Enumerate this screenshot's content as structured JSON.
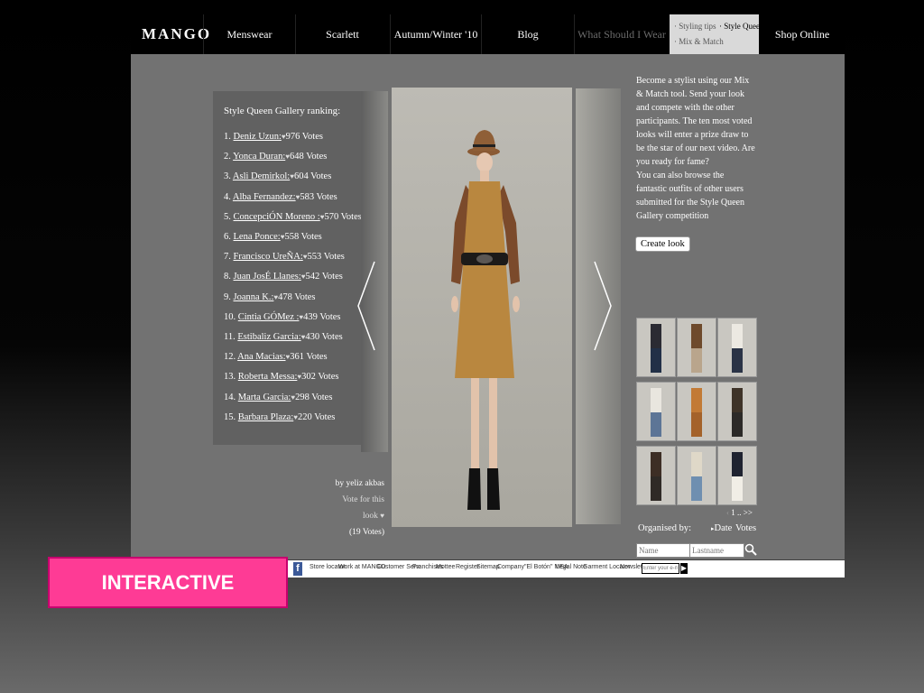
{
  "nav": {
    "logo": "MANGO",
    "items": [
      "Menswear",
      "Scarlett",
      "Autumn/Winter '10",
      "Blog",
      "What Should I Wear"
    ],
    "sub_links": [
      "· Styling tips",
      "· Style Queen",
      "· Mix & Match"
    ],
    "shop_online": "Shop Online"
  },
  "ranking": {
    "title": "Style Queen Gallery ranking:",
    "votes_word": "Votes",
    "entries": [
      {
        "rank": "1.",
        "name": "Deniz Uzun:",
        "votes": "976"
      },
      {
        "rank": "2.",
        "name": "Yonca Duran:",
        "votes": "648"
      },
      {
        "rank": "3.",
        "name": "Asli Demirkol:",
        "votes": "604"
      },
      {
        "rank": "4.",
        "name": "Alba Fernandez:",
        "votes": "583"
      },
      {
        "rank": "5.",
        "name": "ConcepciÓN Moreno :",
        "votes": "570"
      },
      {
        "rank": "6.",
        "name": "Lena Ponce:",
        "votes": "558"
      },
      {
        "rank": "7.",
        "name": "Francisco UreÑA:",
        "votes": "553"
      },
      {
        "rank": "8.",
        "name": "Juan JosÉ Llanes:",
        "votes": "542"
      },
      {
        "rank": "9.",
        "name": "Joanna K.:",
        "votes": "478"
      },
      {
        "rank": "10.",
        "name": "Cintia GÓMez :",
        "votes": "439"
      },
      {
        "rank": "11.",
        "name": "Estibaliz Garcia:",
        "votes": "430"
      },
      {
        "rank": "12.",
        "name": "Ana Macias:",
        "votes": "361"
      },
      {
        "rank": "13.",
        "name": "Roberta Messa:",
        "votes": "302"
      },
      {
        "rank": "14.",
        "name": "Marta Garcia:",
        "votes": "298"
      },
      {
        "rank": "15.",
        "name": "Barbara Plaza:",
        "votes": "220"
      }
    ]
  },
  "look": {
    "author": "by yeliz akbas",
    "vote_label": "Vote for this look",
    "vote_count": "(19 Votes)"
  },
  "intro": {
    "text1": "Become a stylist using our Mix & Match tool. Send your look and compete with the other participants. The ten most voted looks will enter a prize draw to be the star of our next video. Are you ready for fame?",
    "text2": "You can also browse the fantastic outfits of other users submitted for the Style Queen Gallery competition",
    "create_button": "Create look"
  },
  "thumbnails": [
    {
      "top": "#2b2b33",
      "bottom": "#223047"
    },
    {
      "top": "#6e4a2c",
      "bottom": "#b9a58c"
    },
    {
      "top": "#ece9e2",
      "bottom": "#2a3346"
    },
    {
      "top": "#e9e6df",
      "bottom": "#5d7596"
    },
    {
      "top": "#c27a35",
      "bottom": "#a4622a"
    },
    {
      "top": "#3e3328",
      "bottom": "#2c2a28"
    },
    {
      "top": "#3d2e25",
      "bottom": "#2f2a26"
    },
    {
      "top": "#dfd8c8",
      "bottom": "#6f8fb0"
    },
    {
      "top": "#1f2330",
      "bottom": "#f1eee6"
    }
  ],
  "pager": {
    "prev": "‹",
    "page": "1",
    "dots": "..",
    "next": ">>"
  },
  "organise": {
    "label": "Organised by:",
    "date": "Date",
    "votes": "Votes"
  },
  "filters": {
    "name_placeholder": "Name",
    "lastname_placeholder": "Lastname"
  },
  "footer": {
    "links": [
      "Store locator",
      "Work at MANGO",
      "Customer Serv.",
      "Franchises",
      "Mottee",
      "Register",
      "Sitemap",
      "Company",
      "\"El Botón\" MEA",
      "Legal Note",
      "Garment Locator",
      "Newsletter"
    ],
    "newsletter_placeholder": "Enter your e-mail"
  },
  "badge": {
    "label": "INTERACTIVE"
  },
  "colors": {
    "accent": "#fe3b95",
    "nav_bg": "#000000",
    "site_bg": "#727272"
  }
}
